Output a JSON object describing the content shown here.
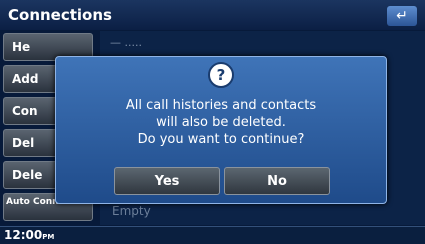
{
  "header": {
    "title": "Connections",
    "back_icon": "back-arrow-icon"
  },
  "sidebar": {
    "items": [
      {
        "label": "He"
      },
      {
        "label": "Add"
      },
      {
        "label": "Con"
      },
      {
        "label": "Del"
      },
      {
        "label": "Dele"
      },
      {
        "label": "Auto Connection"
      }
    ]
  },
  "list": {
    "top_row": "— .....",
    "empty_label": "Empty"
  },
  "dialog": {
    "icon": "question-icon",
    "line1": "All call histories and contacts",
    "line2": "will also be deleted.",
    "line3": "Do you want to continue?",
    "yes_label": "Yes",
    "no_label": "No"
  },
  "status": {
    "time": "12:00",
    "ampm": "PM"
  },
  "colors": {
    "accent": "#3f74b8",
    "background": "#071a3a"
  }
}
